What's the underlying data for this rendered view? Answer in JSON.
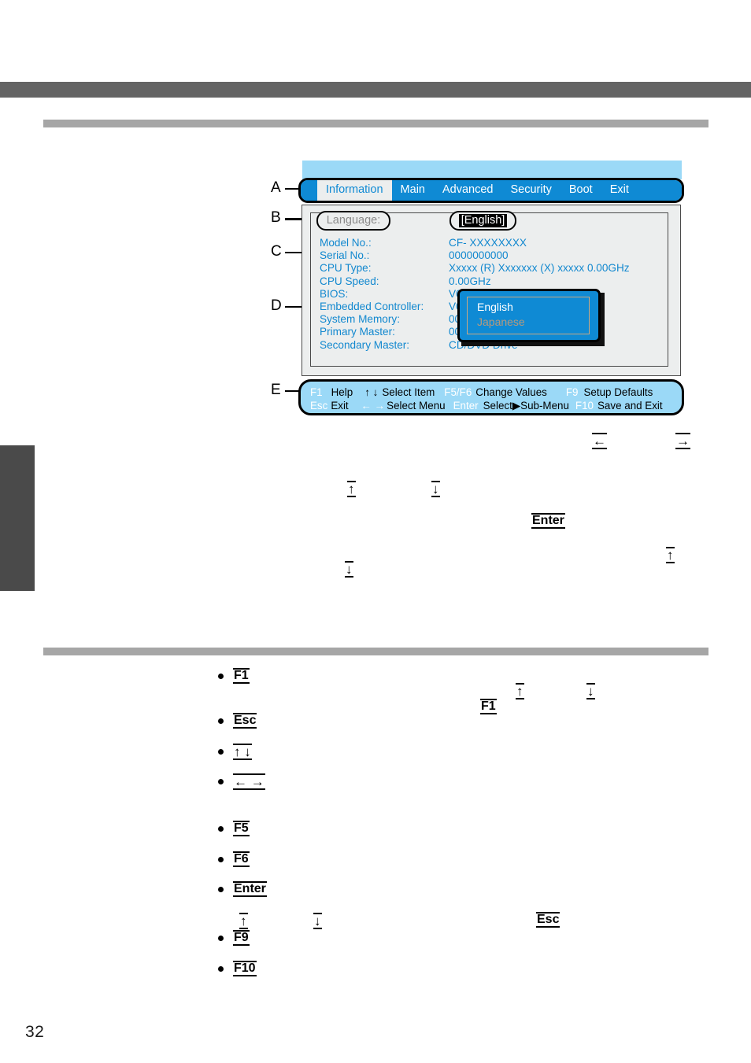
{
  "page": {
    "number": "32"
  },
  "figure": {
    "callouts": [
      {
        "letter": "A"
      },
      {
        "letter": "B"
      },
      {
        "letter": "C"
      },
      {
        "letter": "D"
      },
      {
        "letter": "E"
      }
    ],
    "tabs": [
      {
        "label": "Information",
        "active": true
      },
      {
        "label": "Main",
        "active": false
      },
      {
        "label": "Advanced",
        "active": false
      },
      {
        "label": "Security",
        "active": false
      },
      {
        "label": "Boot",
        "active": false
      },
      {
        "label": "Exit",
        "active": false
      }
    ],
    "language": {
      "label": "Language:",
      "value": "[English]"
    },
    "info_rows": [
      {
        "label": "Model No.:",
        "value": "CF- XXXXXXXX"
      },
      {
        "label": "Serial No.:",
        "value": "0000000000"
      },
      {
        "label": "CPU Type:",
        "value": "Xxxxx (R) Xxxxxxx (X) xxxxx 0.00GHz"
      },
      {
        "label": "CPU Speed:",
        "value": "0.00GHz"
      },
      {
        "label": "BIOS:",
        "value": "V0"
      },
      {
        "label": "Embedded Controller:",
        "value": "V0"
      },
      {
        "label": "System Memory:",
        "value": "00"
      },
      {
        "label": "Primary Master:",
        "value": "00"
      },
      {
        "label": "Secondary Master:",
        "value": "CD/DVD Drive"
      }
    ],
    "dropdown": {
      "items": [
        {
          "label": "English",
          "selected": true
        },
        {
          "label": "Japanese",
          "selected": false
        }
      ]
    },
    "footer": {
      "row1": [
        {
          "key": "F1",
          "desc": "Help"
        },
        {
          "key": "↑ ↓",
          "desc": "Select Item"
        },
        {
          "key": "F5/F6",
          "desc": "Change Values"
        },
        {
          "key": "F9",
          "desc": "Setup Defaults"
        }
      ],
      "row2": [
        {
          "key": "Esc",
          "desc": "Exit"
        },
        {
          "key": "← →",
          "desc": "Select Menu"
        },
        {
          "key": "Enter",
          "desc": "Select▶Sub-Menu"
        },
        {
          "key": "F10",
          "desc": "Save and Exit"
        }
      ]
    }
  },
  "body_keys": {
    "mid_left_arrow": "←",
    "mid_right_arrow": "→",
    "mid_up_arrow": "↑",
    "mid_down_arrow": "↓",
    "mid_enter": "Enter",
    "mid_up_arrow_2": "↑",
    "mid_down_arrow_2": "↓"
  },
  "key_list": {
    "items": [
      {
        "key": "F1"
      },
      {
        "key": "Esc"
      },
      {
        "key": "↑ ↓"
      },
      {
        "key": "← →"
      },
      {
        "key": "F5"
      },
      {
        "key": "F6"
      },
      {
        "key": "Enter"
      },
      {
        "key": "F9"
      },
      {
        "key": "F10"
      }
    ],
    "inline_f1": "F1",
    "inline_up": "↑",
    "inline_down": "↓",
    "inline_up_2": "↑",
    "inline_down_2": "↓",
    "inline_esc": "Esc"
  }
}
